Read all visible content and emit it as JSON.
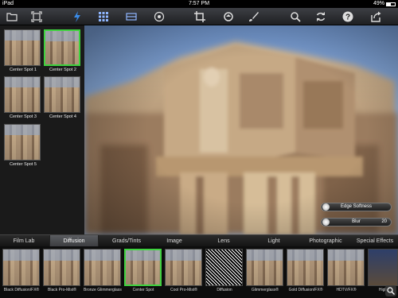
{
  "status_bar": {
    "carrier": "iPad",
    "time": "7:57 PM",
    "battery": "49%"
  },
  "toolbar": {
    "icons": [
      "folder-icon",
      "fit-screen-icon",
      "lightning-icon",
      "grid-icon",
      "split-view-icon",
      "target-icon",
      "crop-icon",
      "rotate-icon",
      "brush-icon",
      "search-icon",
      "refresh-icon",
      "help-icon",
      "share-icon"
    ],
    "active_icon": "lightning-icon",
    "accent_color": "#3a8be8"
  },
  "presets": [
    {
      "label": "Center Spot 1",
      "selected": false
    },
    {
      "label": "Center Spot 2",
      "selected": true
    },
    {
      "label": "Center Spot 3",
      "selected": false
    },
    {
      "label": "Center Spot 4",
      "selected": false
    },
    {
      "label": "Center Spot 5",
      "selected": false
    }
  ],
  "sliders": [
    {
      "label": "Edge Softness",
      "value": ""
    },
    {
      "label": "Blur",
      "value": "20"
    }
  ],
  "categories": {
    "tabs": [
      "Film Lab",
      "Diffusion",
      "Grads/Tints",
      "Image",
      "Lens",
      "Light",
      "Photographic",
      "Special Effects"
    ],
    "active": "Diffusion"
  },
  "filters": [
    {
      "label": "Black Diffusion/FX®",
      "selected": false
    },
    {
      "label": "Black Pro-Mist®",
      "selected": false
    },
    {
      "label": "Bronze Glimmerglass®",
      "selected": false
    },
    {
      "label": "Center Spot",
      "selected": true
    },
    {
      "label": "Cool Pro-Mist®",
      "selected": false
    },
    {
      "label": "Diffusion",
      "selected": false
    },
    {
      "label": "Glimmerglass®",
      "selected": false
    },
    {
      "label": "Gold Diffusion/FX®",
      "selected": false
    },
    {
      "label": "HDTV/FX®",
      "selected": false
    },
    {
      "label": "High",
      "selected": false
    }
  ],
  "selected_color": "#3fd23f"
}
